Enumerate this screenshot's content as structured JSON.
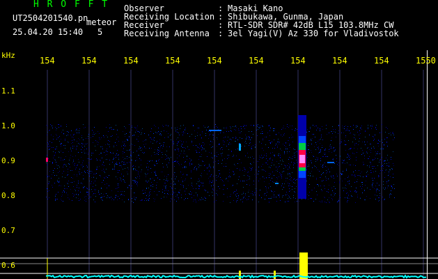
{
  "app": {
    "name": "H R O F F T",
    "filename": "UT2504201540.pn",
    "mode": "meteor",
    "datetime": "25.04.20 15:40",
    "index": "5"
  },
  "header": {
    "observer_label": "Observer",
    "observer_value": "Masaki Kano",
    "location_label": "Receiving Location",
    "location_value": "Shibukawa, Gunma, Japan",
    "receiver_label": "Receiver",
    "receiver_value": "RTL-SDR SDR# 42dB L15 103.8MHz CW",
    "antenna_label": "Receiving Antenna",
    "antenna_value": "3el Yagi(V) Az 330 for Vladivostok",
    "colon": ":"
  },
  "axis": {
    "freq_ticks": [
      "154",
      "154",
      "154",
      "154",
      "154",
      "154",
      "154",
      "154",
      "154",
      "1550"
    ],
    "y_unit": "kHz",
    "y_ticks": [
      "1.1",
      "1.0",
      "0.9",
      "0.8",
      "0.7",
      "0.6"
    ]
  },
  "colors": {
    "title": "#00ff00",
    "text": "#ffffff",
    "axis": "#ffff00",
    "grid": "#ffffff",
    "signal": "#ffff00",
    "baseline": "#00ffff"
  }
}
